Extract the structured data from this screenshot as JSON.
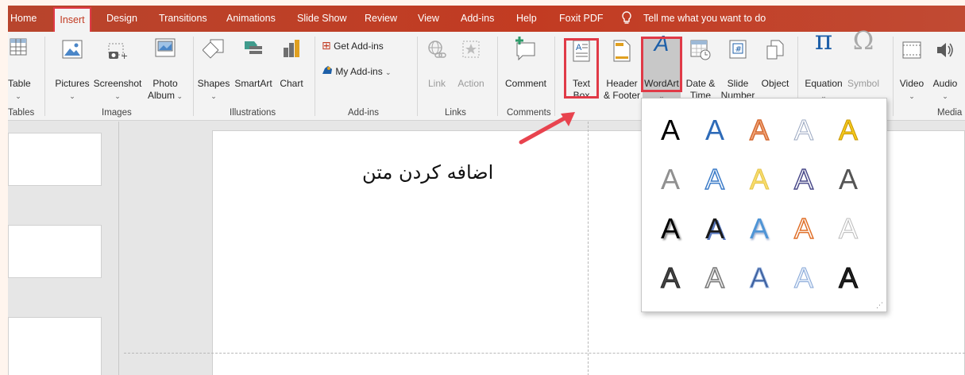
{
  "tabs": {
    "home": "Home",
    "insert": "Insert",
    "design": "Design",
    "transitions": "Transitions",
    "animations": "Animations",
    "slideshow": "Slide Show",
    "review": "Review",
    "view": "View",
    "addins": "Add-ins",
    "help": "Help",
    "foxit": "Foxit PDF",
    "tellme": "Tell me what you want to do"
  },
  "ribbon": {
    "table": "Table",
    "pictures": "Pictures",
    "screenshot": "Screenshot",
    "photo_album_1": "Photo",
    "photo_album_2": "Album",
    "shapes": "Shapes",
    "smartart": "SmartArt",
    "chart": "Chart",
    "get_addins": "Get Add-ins",
    "my_addins": "My Add-ins",
    "link": "Link",
    "action": "Action",
    "comment": "Comment",
    "textbox_1": "Text",
    "textbox_2": "Box",
    "header_1": "Header",
    "header_2": "& Footer",
    "wordart": "WordArt",
    "datetime_1": "Date &",
    "datetime_2": "Time",
    "slidenum_1": "Slide",
    "slidenum_2": "Number",
    "object": "Object",
    "equation": "Equation",
    "symbol": "Symbol",
    "video": "Video",
    "audio": "Audio"
  },
  "groups": {
    "tables": "Tables",
    "images": "Images",
    "illustrations": "Illustrations",
    "addins": "Add-ins",
    "links": "Links",
    "comments": "Comments",
    "media": "Media"
  },
  "annotation": "اضافه کردن متن",
  "wordart_glyph": "A",
  "colors": {
    "accent": "#c23b22",
    "highlight": "#e03a47",
    "arrow": "#e8434e"
  }
}
